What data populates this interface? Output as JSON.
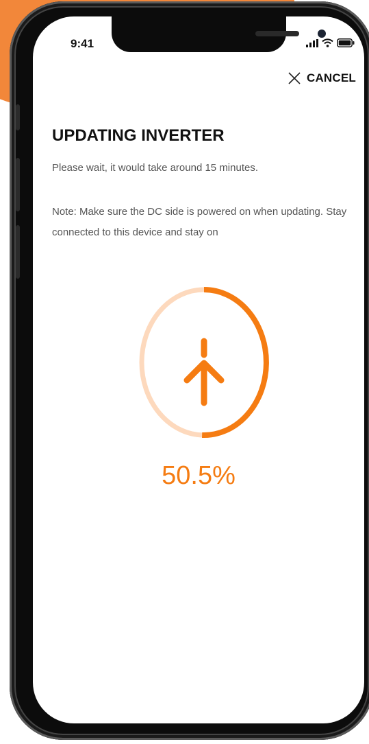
{
  "status_bar": {
    "time": "9:41"
  },
  "header": {
    "cancel_label": "CANCEL"
  },
  "content": {
    "title": "UPDATING INVERTER",
    "subtitle": "Please wait, it would take around 15 minutes.",
    "note": "Note: Make sure the DC side is powered on when updating. Stay connected to this device and stay on"
  },
  "progress": {
    "percent": 50.5,
    "percent_label": "50.5%"
  },
  "colors": {
    "accent": "#f57c12",
    "track": "#fdd9bd",
    "background_accent": "#f2873a"
  },
  "icons": {
    "cancel": "close-icon",
    "progress": "upload-arrow-icon",
    "signal": "signal-icon",
    "wifi": "wifi-icon",
    "battery": "battery-icon"
  }
}
